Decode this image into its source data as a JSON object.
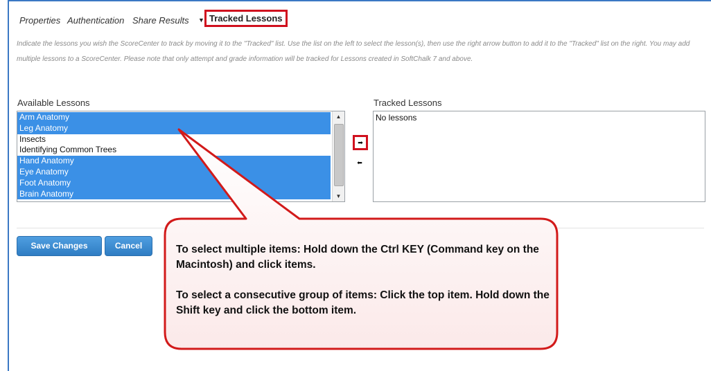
{
  "tabs": {
    "properties": "Properties",
    "authentication": "Authentication",
    "share_results": "Share Results",
    "tracked_lessons": "Tracked Lessons"
  },
  "instructions": "Indicate the lessons you wish the ScoreCenter to track by moving it to the \"Tracked\" list. Use the list on the left to select the lesson(s), then use the right arrow button to add it to the \"Tracked\" list on the right. You may add multiple lessons to a ScoreCenter. Please note that only attempt and grade information will be tracked for Lessons created in SoftChalk 7 and above.",
  "available": {
    "label": "Available Lessons",
    "items": [
      {
        "label": "Arm Anatomy",
        "selected": true
      },
      {
        "label": "Leg Anatomy",
        "selected": true
      },
      {
        "label": "Insects",
        "selected": false
      },
      {
        "label": "Identifying Common Trees",
        "selected": false
      },
      {
        "label": "Hand Anatomy",
        "selected": true
      },
      {
        "label": "Eye Anatomy",
        "selected": true
      },
      {
        "label": "Foot Anatomy",
        "selected": true
      },
      {
        "label": "Brain Anatomy",
        "selected": true
      }
    ]
  },
  "tracked": {
    "label": "Tracked Lessons",
    "empty_text": "No lessons"
  },
  "buttons": {
    "save": "Save Changes",
    "cancel": "Cancel",
    "move_right_icon": "arrow-right-icon",
    "move_left_icon": "arrow-left-icon"
  },
  "callout": {
    "line1": "To select multiple items: Hold down the Ctrl KEY (Command key on the Macintosh) and click items.",
    "line2": "To select a consecutive group of items: Click the top item. Hold down the Shift key and click the bottom item."
  },
  "colors": {
    "selection": "#3b90e6",
    "highlight_border": "#d0101e",
    "button": "#3a87cf",
    "frame": "#3a78c4"
  }
}
